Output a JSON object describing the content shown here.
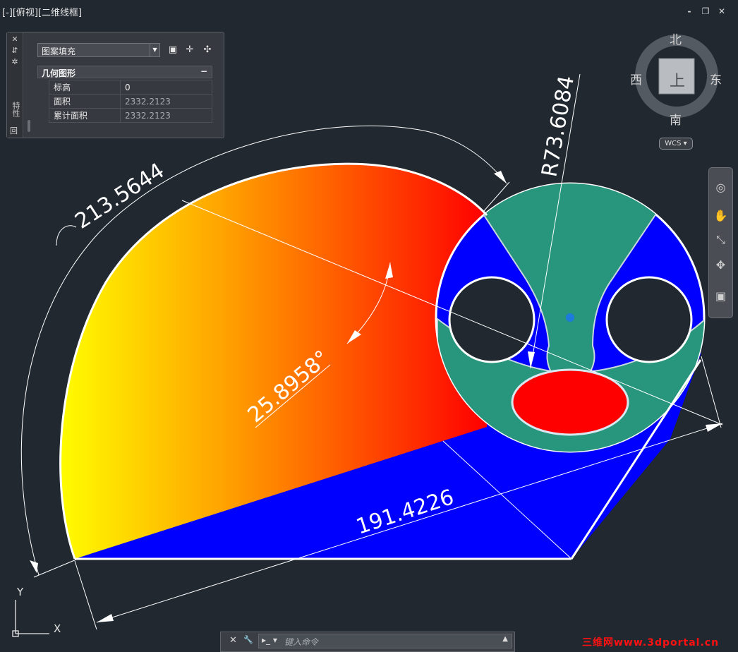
{
  "viewport": {
    "label": "[-][俯视][二维线框]",
    "controls": [
      "-",
      "❐",
      "✕"
    ]
  },
  "properties_panel": {
    "side_icons": [
      "✕",
      "⇵",
      "✲"
    ],
    "side_title": "特性",
    "bottom_icon": "回",
    "object_type": "图案填充",
    "toolbar_icons": [
      "quick-select-icon",
      "select-objects-icon",
      "toggle-pickadd-icon"
    ],
    "section_title": "几何图形",
    "section_toggle": "−",
    "rows": [
      {
        "label": "标高",
        "value": "0"
      },
      {
        "label": "面积",
        "value": "2332.2123"
      },
      {
        "label": "累计面积",
        "value": "2332.2123"
      }
    ]
  },
  "viewcube": {
    "north": "北",
    "south": "南",
    "east": "东",
    "west": "西",
    "face": "上",
    "wcs_label": "WCS"
  },
  "navbar": {
    "icons": [
      "steering-wheel-icon",
      "pan-icon",
      "zoom-icon",
      "orbit-icon",
      "showmotion-icon"
    ]
  },
  "ucs": {
    "x_label": "X",
    "y_label": "Y"
  },
  "dimensions": {
    "arc_length": "213.5644",
    "radius": "R73.6084",
    "angle": "25.8958°",
    "linear": "191.4226"
  },
  "command_line": {
    "placeholder": "键入命令",
    "close_icon": "✕",
    "settings_icon": "🔧",
    "up_icon": "▲"
  },
  "watermark": "三维网www.3dportal.cn",
  "colors": {
    "background": "#212830",
    "gradient_start": "#ffff00",
    "gradient_end": "#ff0000",
    "blue_fill": "#0000ff",
    "teal_fill": "#27967d",
    "red_fill": "#ff0000"
  }
}
